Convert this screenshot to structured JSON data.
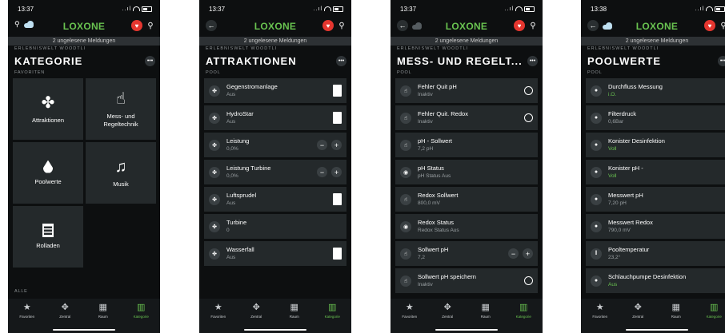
{
  "logo": "LOXONE",
  "notice": "2 ungelesene Meldungen",
  "location": "ERLEBNISWELT WOODTLI",
  "tabs": [
    {
      "label": "Favoriten",
      "icon": "star-icon"
    },
    {
      "label": "Zentral",
      "icon": "central-icon"
    },
    {
      "label": "Raum",
      "icon": "room-icon"
    },
    {
      "label": "Kategorie",
      "icon": "category-icon"
    }
  ],
  "screens": [
    {
      "time": "13:37",
      "title": "KATEGORIE",
      "section": "FAVORITEN",
      "tiles": [
        {
          "label": "Attraktionen",
          "icon": "fan-icon"
        },
        {
          "label": "Mess- und\nRegeltechnik",
          "icon": "hand-pointer-icon"
        },
        {
          "label": "Poolwerte",
          "icon": "drop-icon"
        },
        {
          "label": "Musik",
          "icon": "music-note-icon"
        },
        {
          "label": "Rolladen",
          "icon": "blinds-icon"
        }
      ],
      "section_bottom": "ALLE"
    },
    {
      "time": "13:37",
      "title": "ATTRAKTIONEN",
      "section": "POOL",
      "rows": [
        {
          "name": "Gegenstromanlage",
          "value": "Aus",
          "control": "switch"
        },
        {
          "name": "HydroStar",
          "value": "Aus",
          "control": "switch"
        },
        {
          "name": "Leistung",
          "value": "0,0%",
          "control": "plusminus"
        },
        {
          "name": "Leistung Turbine",
          "value": "0,0%",
          "control": "plusminus"
        },
        {
          "name": "Luftsprudel",
          "value": "Aus",
          "control": "switch"
        },
        {
          "name": "Turbine",
          "value": "0",
          "control": "none"
        },
        {
          "name": "Wasserfall",
          "value": "Aus",
          "control": "switch"
        }
      ]
    },
    {
      "time": "13:37",
      "title": "MESS- UND REGELT...",
      "section": "POOL",
      "rows": [
        {
          "name": "Fehler Quit pH",
          "value": "Inaktiv",
          "control": "circle",
          "icon": "hand"
        },
        {
          "name": "Fehler Quit. Redox",
          "value": "Inaktiv",
          "control": "circle",
          "icon": "hand"
        },
        {
          "name": "pH - Sollwert",
          "value": "7,2 pH",
          "control": "none",
          "icon": "hand"
        },
        {
          "name": "pH Status",
          "value": "pH Status Aus",
          "control": "none",
          "icon": "dot"
        },
        {
          "name": "Redox Sollwert",
          "value": "800,0 mV",
          "control": "none",
          "icon": "hand"
        },
        {
          "name": "Redox Status",
          "value": "Redox Status Aus",
          "control": "none",
          "icon": "dot"
        },
        {
          "name": "Sollwert pH",
          "value": "7,2",
          "control": "plusminus",
          "icon": "hand"
        },
        {
          "name": "Sollwert pH speichern",
          "value": "Inaktiv",
          "control": "circle",
          "icon": "hand"
        }
      ]
    },
    {
      "time": "13:38",
      "title": "POOLWERTE",
      "section": "POOL",
      "rows": [
        {
          "name": "Durchfluss Messung",
          "value": "i.O.",
          "status": "ok",
          "icon": "drop"
        },
        {
          "name": "Filterdruck",
          "value": "0,6Bar",
          "status": "",
          "icon": "drop"
        },
        {
          "name": "Konister Desinfektion",
          "value": "Voll",
          "status": "ok",
          "icon": "drop"
        },
        {
          "name": "Konister pH -",
          "value": "Voll",
          "status": "ok",
          "icon": "drop"
        },
        {
          "name": "Messwert pH",
          "value": "7,20 pH",
          "status": "",
          "icon": "drop"
        },
        {
          "name": "Messwert Redox",
          "value": "790,0 mV",
          "status": "",
          "icon": "drop"
        },
        {
          "name": "Pooltemperatur",
          "value": "23,2°",
          "status": "",
          "icon": "thermo"
        },
        {
          "name": "Schlauchpumpe Desinfektion",
          "value": "Aus",
          "status": "ok",
          "icon": "drop"
        }
      ]
    }
  ]
}
